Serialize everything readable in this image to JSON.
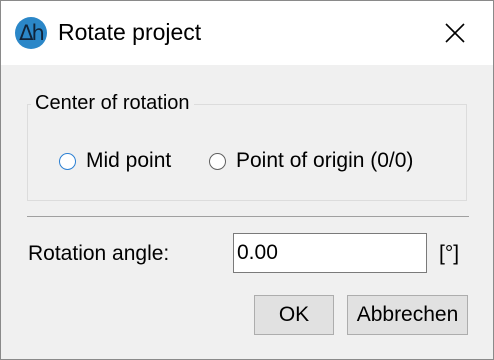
{
  "window": {
    "title": "Rotate project",
    "app_icon_text": "Δh",
    "app_icon_color": "#2b87c8",
    "close_icon": "close-icon"
  },
  "center_group": {
    "legend": "Center of rotation",
    "options": [
      {
        "label": "Mid point",
        "selected": false
      },
      {
        "label": "Point of origin (0/0)",
        "selected": false
      }
    ]
  },
  "angle": {
    "label": "Rotation angle:",
    "value": "0.00",
    "unit": "[°]"
  },
  "buttons": {
    "ok": "OK",
    "cancel": "Abbrechen"
  }
}
